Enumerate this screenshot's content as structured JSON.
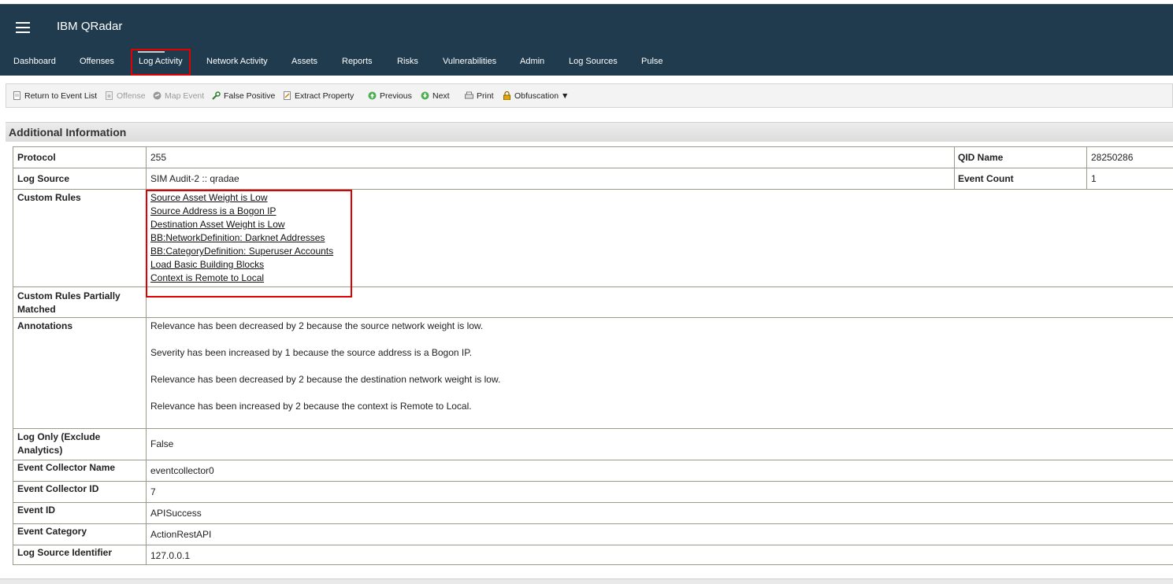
{
  "header": {
    "app_title": "IBM QRadar"
  },
  "nav": {
    "items": [
      {
        "label": "Dashboard"
      },
      {
        "label": "Offenses"
      },
      {
        "label": "Log Activity"
      },
      {
        "label": "Network Activity"
      },
      {
        "label": "Assets"
      },
      {
        "label": "Reports"
      },
      {
        "label": "Risks"
      },
      {
        "label": "Vulnerabilities"
      },
      {
        "label": "Admin"
      },
      {
        "label": "Log Sources"
      },
      {
        "label": "Pulse"
      }
    ]
  },
  "toolbar": {
    "return_label": "Return to Event List",
    "offense_label": "Offense",
    "map_event_label": "Map Event",
    "false_positive_label": "False Positive",
    "extract_property_label": "Extract Property",
    "previous_label": "Previous",
    "next_label": "Next",
    "print_label": "Print",
    "obfuscation_label": "Obfuscation ▼"
  },
  "section": {
    "title": "Additional Information"
  },
  "details": {
    "protocol": {
      "label": "Protocol",
      "value": "255"
    },
    "qid_name": {
      "label": "QID Name",
      "value": "28250286"
    },
    "log_source": {
      "label": "Log Source",
      "value": "SIM Audit-2 :: qradae"
    },
    "event_count": {
      "label": "Event Count",
      "value": "1"
    },
    "custom_rules": {
      "label": "Custom Rules",
      "rules": [
        "Source Asset Weight is Low",
        "Source Address is a Bogon IP",
        "Destination Asset Weight is Low",
        "BB:NetworkDefinition: Darknet Addresses",
        "BB:CategoryDefinition: Superuser Accounts",
        "Load Basic Building Blocks",
        "Context is Remote to Local"
      ]
    },
    "custom_rules_partial": {
      "label_line1": "Custom Rules Partially",
      "label_line2": "Matched",
      "value": ""
    },
    "annotations": {
      "label": "Annotations",
      "items": [
        "Relevance has been decreased by 2 because the source network weight is low.",
        "Severity has been increased by 1 because the source address is a Bogon IP.",
        "Relevance has been decreased by 2 because the destination network weight is low.",
        "Relevance has been increased by 2 because the context is Remote to Local."
      ]
    },
    "log_only": {
      "label_line1": "Log Only (Exclude",
      "label_line2": "Analytics)",
      "value": "False"
    },
    "event_collector_name": {
      "label": "Event Collector Name",
      "value": "eventcollector0"
    },
    "event_collector_id": {
      "label": "Event Collector ID",
      "value": "7"
    },
    "event_id": {
      "label": "Event ID",
      "value": "APISuccess"
    },
    "event_category": {
      "label": "Event Category",
      "value": "ActionRestAPI"
    },
    "log_source_identifier": {
      "label": "Log Source Identifier",
      "value": "127.0.0.1"
    }
  }
}
